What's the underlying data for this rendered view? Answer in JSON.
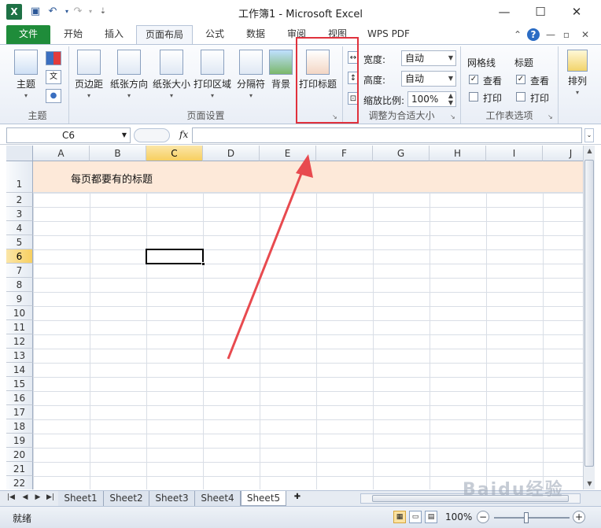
{
  "titlebar": {
    "logo": "X",
    "title": "工作簿1 - Microsoft Excel",
    "minimize": "—",
    "maximize": "☐",
    "close": "✕"
  },
  "tabs": {
    "file": "文件",
    "items": [
      "开始",
      "插入",
      "页面布局",
      "公式",
      "数据",
      "审阅",
      "视图",
      "WPS PDF"
    ],
    "active": "页面布局"
  },
  "ribbon": {
    "theme_group": {
      "label": "主题",
      "theme_btn": "主题"
    },
    "page_setup_group": {
      "label": "页面设置",
      "buttons": [
        "页边距",
        "纸张方向",
        "纸张大小",
        "打印区域",
        "分隔符",
        "背景",
        "打印标题"
      ]
    },
    "scale_group": {
      "label": "调整为合适大小",
      "width_label": "宽度:",
      "width_value": "自动",
      "height_label": "高度:",
      "height_value": "自动",
      "scale_label": "缩放比例:",
      "scale_value": "100%"
    },
    "sheet_options_group": {
      "label": "工作表选项",
      "gridlines": "网格线",
      "headings": "标题",
      "view": "查看",
      "print": "打印"
    },
    "arrange": {
      "label": "排列"
    }
  },
  "formula_bar": {
    "name_box": "C6",
    "fx": "fx",
    "value": ""
  },
  "grid": {
    "columns": [
      "A",
      "B",
      "C",
      "D",
      "E",
      "F",
      "G",
      "H",
      "I",
      "J"
    ],
    "rows": [
      "1",
      "2",
      "3",
      "4",
      "5",
      "6",
      "7",
      "8",
      "9",
      "10",
      "11",
      "12",
      "13",
      "14",
      "15",
      "16",
      "17",
      "18",
      "19",
      "20",
      "21",
      "22"
    ],
    "selected_column": "C",
    "selected_row": "6",
    "title_cell_text": "每页都要有的标题"
  },
  "sheets": {
    "tabs": [
      "Sheet1",
      "Sheet2",
      "Sheet3",
      "Sheet4",
      "Sheet5"
    ],
    "active": "Sheet5"
  },
  "status": {
    "mode": "就绪",
    "zoom": "100%"
  },
  "watermark": "Baidu经验",
  "colors": {
    "file_tab": "#1f8c3a",
    "title_row_fill": "#fde9d9",
    "annotation_red": "#e0313c",
    "selection_header": "#f7cf60"
  }
}
